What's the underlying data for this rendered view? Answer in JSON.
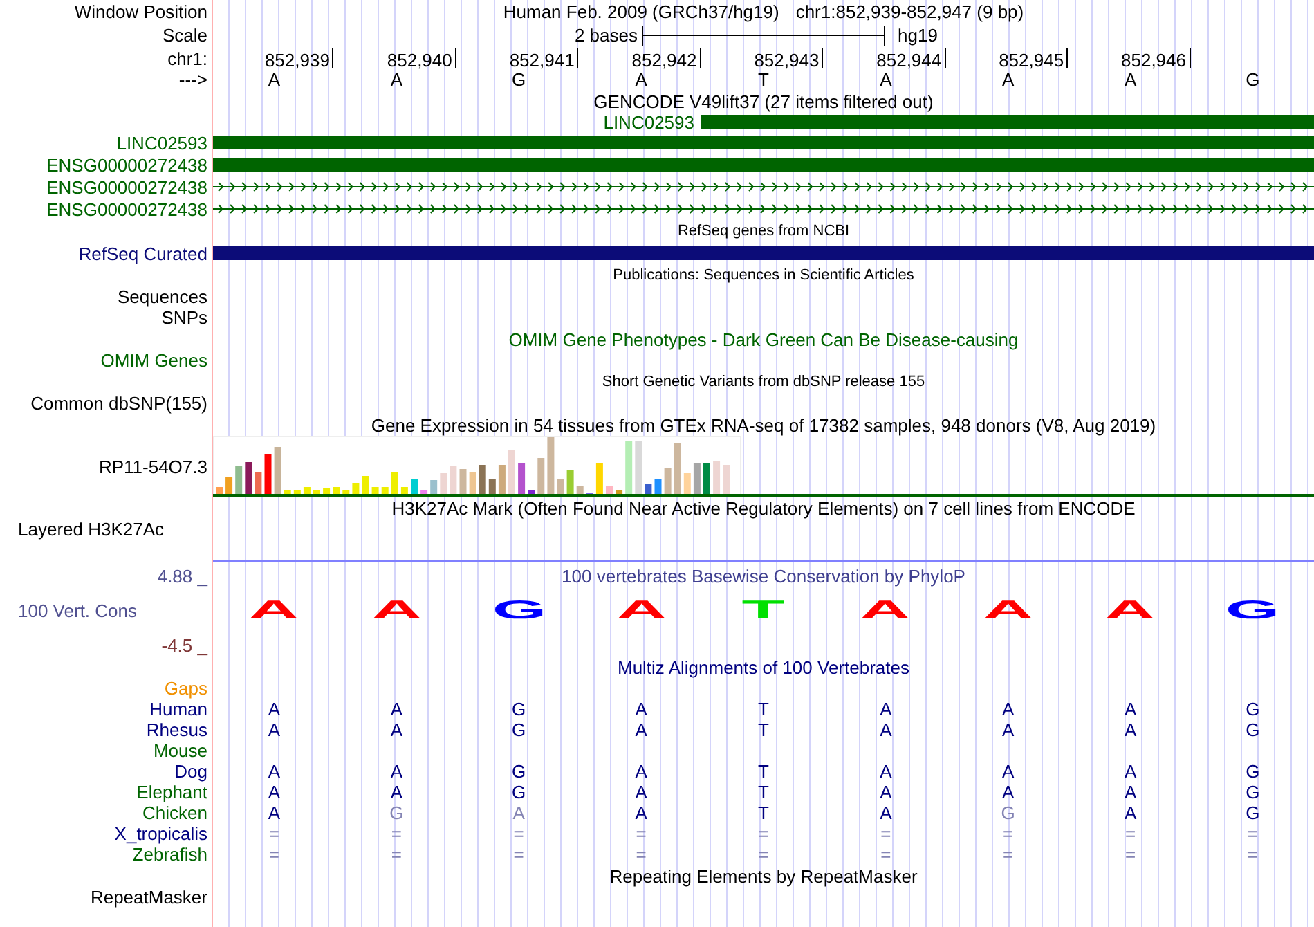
{
  "rows": [
    {
      "kind": "position",
      "label": "Window Position",
      "assembly": "Human Feb. 2009 (GRCh37/hg19)",
      "range": "chr1:852,939-852,947 (9 bp)"
    },
    {
      "kind": "scale",
      "label": "Scale",
      "scale_text": "2 bases",
      "assembly_tag": "hg19"
    },
    {
      "kind": "ruler",
      "label": "chr1:",
      "ticks": [
        "852,939",
        "852,940",
        "852,941",
        "852,942",
        "852,943",
        "852,944",
        "852,945",
        "852,946"
      ]
    },
    {
      "kind": "sequence",
      "label": "--->",
      "bases": [
        "A",
        "A",
        "G",
        "A",
        "T",
        "A",
        "A",
        "A",
        "G"
      ]
    },
    {
      "kind": "title",
      "text": "GENCODE V49lift37 (27 items filtered out)",
      "color": "#000000"
    },
    {
      "kind": "inline_bar",
      "name": "LINC02593",
      "color": "#006400"
    },
    {
      "kind": "bar",
      "label": "LINC02593",
      "color": "#006400"
    },
    {
      "kind": "bar",
      "label": "ENSG00000272438",
      "color": "#006400"
    },
    {
      "kind": "strand",
      "label": "ENSG00000272438",
      "color": "#006400"
    },
    {
      "kind": "strand",
      "label": "ENSG00000272438",
      "color": "#006400"
    },
    {
      "kind": "note",
      "text": "RefSeq genes from NCBI",
      "color": "#000000"
    },
    {
      "kind": "bar",
      "label": "RefSeq Curated",
      "color": "#0c0c78"
    },
    {
      "kind": "note",
      "text": "Publications: Sequences in Scientific Articles",
      "color": "#000000"
    },
    {
      "kind": "label",
      "label": "Sequences",
      "color": "#000000"
    },
    {
      "kind": "label",
      "label": "SNPs",
      "color": "#000000"
    },
    {
      "kind": "title",
      "text": "OMIM Gene Phenotypes - Dark Green Can Be Disease-causing",
      "color": "#006400"
    },
    {
      "kind": "label",
      "label": "OMIM Genes",
      "color": "#006400"
    },
    {
      "kind": "note",
      "text": "Short Genetic Variants from dbSNP release 155",
      "color": "#000000"
    },
    {
      "kind": "label",
      "label": "Common dbSNP(155)",
      "color": "#000000"
    },
    {
      "kind": "title",
      "text": "Gene Expression in 54 tissues from GTEx RNA-seq of 17382 samples, 948 donors (V8, Aug 2019)",
      "color": "#000000"
    },
    {
      "kind": "expression",
      "label": "RP11-54O7.3"
    },
    {
      "kind": "title",
      "text": "H3K27Ac Mark (Often Found Near Active Regulatory Elements) on 7 cell lines from ENCODE",
      "color": "#000000"
    },
    {
      "kind": "group",
      "label": "Layered H3K27Ac"
    },
    {
      "kind": "conservation",
      "top_tick": "4.88 _",
      "label": "100 Vert. Cons",
      "bottom_tick": "-4.5 _",
      "title": "100 vertebrates Basewise Conservation by PhyloP",
      "letters": [
        {
          "base": "A",
          "color": "#ff0000"
        },
        {
          "base": "A",
          "color": "#ff0000"
        },
        {
          "base": "G",
          "color": "#0000ff"
        },
        {
          "base": "A",
          "color": "#ff0000"
        },
        {
          "base": "T",
          "color": "#00e000"
        },
        {
          "base": "A",
          "color": "#ff0000"
        },
        {
          "base": "A",
          "color": "#ff0000"
        },
        {
          "base": "A",
          "color": "#ff0000"
        },
        {
          "base": "G",
          "color": "#0000ff"
        }
      ]
    },
    {
      "kind": "title",
      "text": "Multiz Alignments of 100 Vertebrates",
      "color": "#000080"
    },
    {
      "kind": "label",
      "label": "Gaps",
      "color": "#f09000"
    },
    {
      "kind": "species",
      "label": "Human",
      "color": "#000080",
      "bases": [
        {
          "text": "A",
          "faded": false
        },
        {
          "text": "A",
          "faded": false
        },
        {
          "text": "G",
          "faded": false
        },
        {
          "text": "A",
          "faded": false
        },
        {
          "text": "T",
          "faded": false
        },
        {
          "text": "A",
          "faded": false
        },
        {
          "text": "A",
          "faded": false
        },
        {
          "text": "A",
          "faded": false
        },
        {
          "text": "G",
          "faded": false
        }
      ]
    },
    {
      "kind": "species",
      "label": "Rhesus",
      "color": "#000080",
      "bases": [
        {
          "text": "A",
          "faded": false
        },
        {
          "text": "A",
          "faded": false
        },
        {
          "text": "G",
          "faded": false
        },
        {
          "text": "A",
          "faded": false
        },
        {
          "text": "T",
          "faded": false
        },
        {
          "text": "A",
          "faded": false
        },
        {
          "text": "A",
          "faded": false
        },
        {
          "text": "A",
          "faded": false
        },
        {
          "text": "G",
          "faded": false
        }
      ]
    },
    {
      "kind": "species",
      "label": "Mouse",
      "color": "#006400"
    },
    {
      "kind": "species",
      "label": "Dog",
      "color": "#000080",
      "bases": [
        {
          "text": "A",
          "faded": false
        },
        {
          "text": "A",
          "faded": false
        },
        {
          "text": "G",
          "faded": false
        },
        {
          "text": "A",
          "faded": false
        },
        {
          "text": "T",
          "faded": false
        },
        {
          "text": "A",
          "faded": false
        },
        {
          "text": "A",
          "faded": false
        },
        {
          "text": "A",
          "faded": false
        },
        {
          "text": "G",
          "faded": false
        }
      ]
    },
    {
      "kind": "species",
      "label": "Elephant",
      "color": "#006400",
      "bases": [
        {
          "text": "A",
          "faded": false
        },
        {
          "text": "A",
          "faded": false
        },
        {
          "text": "G",
          "faded": false
        },
        {
          "text": "A",
          "faded": false
        },
        {
          "text": "T",
          "faded": false
        },
        {
          "text": "A",
          "faded": false
        },
        {
          "text": "A",
          "faded": false
        },
        {
          "text": "A",
          "faded": false
        },
        {
          "text": "G",
          "faded": false
        }
      ]
    },
    {
      "kind": "species",
      "label": "Chicken",
      "color": "#006400",
      "bases": [
        {
          "text": "A",
          "faded": false
        },
        {
          "text": "G",
          "faded": true
        },
        {
          "text": "A",
          "faded": true
        },
        {
          "text": "A",
          "faded": false
        },
        {
          "text": "T",
          "faded": false
        },
        {
          "text": "A",
          "faded": false
        },
        {
          "text": "G",
          "faded": true
        },
        {
          "text": "A",
          "faded": false
        },
        {
          "text": "G",
          "faded": false
        }
      ]
    },
    {
      "kind": "species",
      "label": "X_tropicalis",
      "color": "#000080",
      "bases": [
        {
          "text": "=",
          "faded": true
        },
        {
          "text": "=",
          "faded": true
        },
        {
          "text": "=",
          "faded": true
        },
        {
          "text": "=",
          "faded": true
        },
        {
          "text": "=",
          "faded": true
        },
        {
          "text": "=",
          "faded": true
        },
        {
          "text": "=",
          "faded": true
        },
        {
          "text": "=",
          "faded": true
        },
        {
          "text": "=",
          "faded": true
        }
      ]
    },
    {
      "kind": "species",
      "label": "Zebrafish",
      "color": "#006400",
      "bases": [
        {
          "text": "=",
          "faded": true
        },
        {
          "text": "=",
          "faded": true
        },
        {
          "text": "=",
          "faded": true
        },
        {
          "text": "=",
          "faded": true
        },
        {
          "text": "=",
          "faded": true
        },
        {
          "text": "=",
          "faded": true
        },
        {
          "text": "=",
          "faded": true
        },
        {
          "text": "=",
          "faded": true
        },
        {
          "text": "=",
          "faded": true
        }
      ]
    },
    {
      "kind": "title",
      "text": "Repeating Elements by RepeatMasker",
      "color": "#000000"
    },
    {
      "kind": "label",
      "label": "RepeatMasker",
      "color": "#000000"
    }
  ]
}
